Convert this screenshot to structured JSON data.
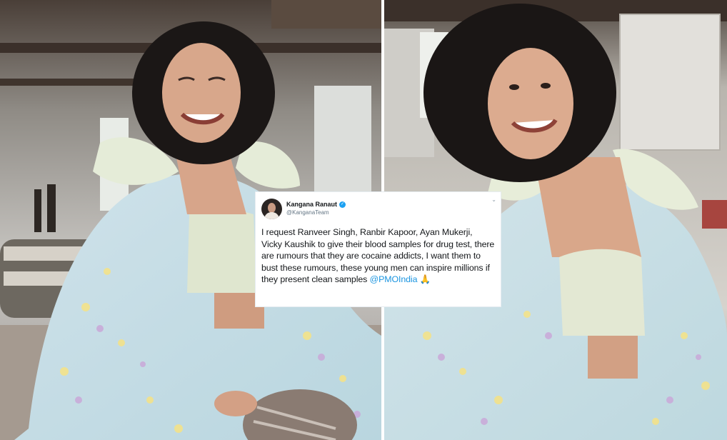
{
  "tweet": {
    "display_name": "Kangana Ranaut",
    "handle": "@KanganaTeam",
    "text": "I request Ranveer Singh, Ranbir Kapoor, Ayan Mukerji, Vicky Kaushik to give their blood samples for drug test, there are rumours that they are cocaine addicts, I want them to bust these rumours, these young men can inspire millions if they present clean samples",
    "mention": "@PMOIndia",
    "emoji": "🙏",
    "colors": {
      "link": "#1b95e0",
      "verified": "#1da1f2"
    }
  },
  "photos": {
    "left": "woman in pastel floral saree with ruffled blouse, laughing, curly dark hair, seated indoors",
    "right": "same woman smiling at camera, pastel floral saree and embroidered blouse"
  }
}
